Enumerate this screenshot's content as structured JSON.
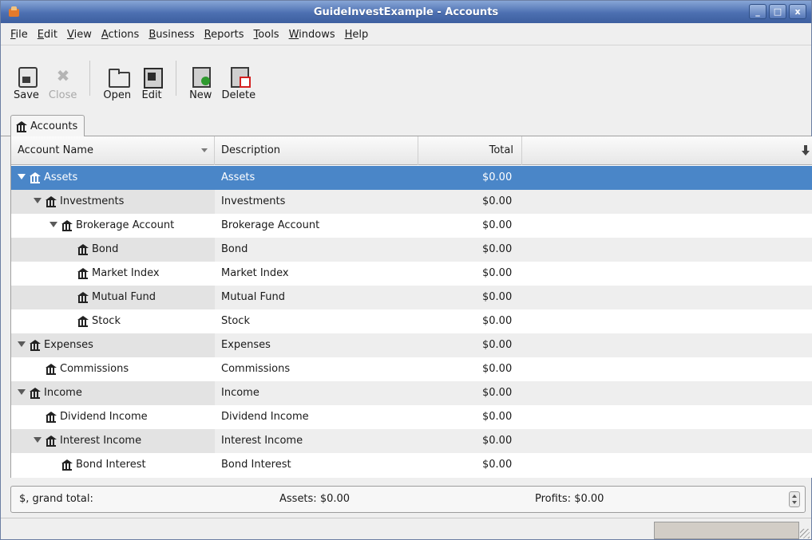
{
  "window": {
    "title": "GuideInvestExample - Accounts",
    "minimize_glyph": "_",
    "maximize_glyph": "□",
    "close_glyph": "x"
  },
  "menu": [
    {
      "accel": "F",
      "rest": "ile"
    },
    {
      "accel": "E",
      "rest": "dit"
    },
    {
      "accel": "V",
      "rest": "iew"
    },
    {
      "accel": "A",
      "rest": "ctions"
    },
    {
      "accel": "B",
      "rest": "usiness"
    },
    {
      "accel": "R",
      "rest": "eports"
    },
    {
      "accel": "T",
      "rest": "ools"
    },
    {
      "accel": "W",
      "rest": "indows"
    },
    {
      "accel": "H",
      "rest": "elp"
    }
  ],
  "toolbar": {
    "save": "Save",
    "close": "Close",
    "open": "Open",
    "edit": "Edit",
    "new": "New",
    "delete": "Delete"
  },
  "tab": {
    "label": "Accounts"
  },
  "columns": {
    "name": "Account Name",
    "description": "Description",
    "total": "Total"
  },
  "accounts": [
    {
      "name": "Assets",
      "description": "Assets",
      "total": "$0.00",
      "level": 0,
      "expanded": true,
      "selected": true
    },
    {
      "name": "Investments",
      "description": "Investments",
      "total": "$0.00",
      "level": 1,
      "expanded": true
    },
    {
      "name": "Brokerage Account",
      "description": "Brokerage Account",
      "total": "$0.00",
      "level": 2,
      "expanded": true
    },
    {
      "name": "Bond",
      "description": "Bond",
      "total": "$0.00",
      "level": 3
    },
    {
      "name": "Market Index",
      "description": "Market Index",
      "total": "$0.00",
      "level": 3
    },
    {
      "name": "Mutual Fund",
      "description": "Mutual Fund",
      "total": "$0.00",
      "level": 3
    },
    {
      "name": "Stock",
      "description": "Stock",
      "total": "$0.00",
      "level": 3
    },
    {
      "name": "Expenses",
      "description": "Expenses",
      "total": "$0.00",
      "level": 0,
      "expanded": true
    },
    {
      "name": "Commissions",
      "description": "Commissions",
      "total": "$0.00",
      "level": 1
    },
    {
      "name": "Income",
      "description": "Income",
      "total": "$0.00",
      "level": 0,
      "expanded": true
    },
    {
      "name": "Dividend Income",
      "description": "Dividend Income",
      "total": "$0.00",
      "level": 1
    },
    {
      "name": "Interest Income",
      "description": "Interest Income",
      "total": "$0.00",
      "level": 1,
      "expanded": true
    },
    {
      "name": "Bond Interest",
      "description": "Bond Interest",
      "total": "$0.00",
      "level": 2
    }
  ],
  "summary": {
    "label": "$, grand total:",
    "assets": "Assets: $0.00",
    "profits": "Profits: $0.00"
  },
  "colors": {
    "selection": "#4a86c8",
    "titlebar": "#4c6fb1"
  }
}
